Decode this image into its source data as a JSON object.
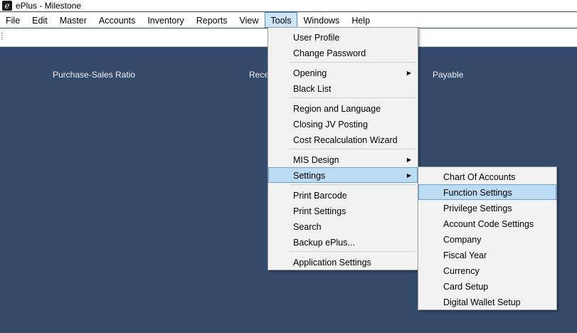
{
  "window": {
    "title": "ePlus - Milestone",
    "icon": "eplus-logo-icon"
  },
  "menubar": {
    "items": [
      "File",
      "Edit",
      "Master",
      "Accounts",
      "Inventory",
      "Reports",
      "View",
      "Tools",
      "Windows",
      "Help"
    ],
    "active": "Tools"
  },
  "workspace": {
    "labels": [
      "Purchase-Sales Ratio",
      "Rece",
      "Payable"
    ]
  },
  "tools_menu": {
    "items": [
      "User Profile",
      "Change Password",
      "Opening",
      "Black List",
      "Region and Language",
      "Closing JV Posting",
      "Cost Recalculation Wizard",
      "MIS Design",
      "Settings",
      "Print Barcode",
      "Print Settings",
      "Search",
      "Backup ePlus...",
      "Application Settings"
    ]
  },
  "settings_submenu": {
    "items": [
      "Chart Of Accounts",
      "Function Settings",
      "Privilege Settings",
      "Account Code Settings",
      "Company",
      "Fiscal Year",
      "Currency",
      "Card Setup",
      "Digital Wallet Setup"
    ],
    "highlighted": "Function Settings"
  },
  "colors": {
    "workspace_bg": "#344a6b",
    "highlight_bg": "#bcdcf4",
    "menu_active_bg": "#cce4f7"
  }
}
